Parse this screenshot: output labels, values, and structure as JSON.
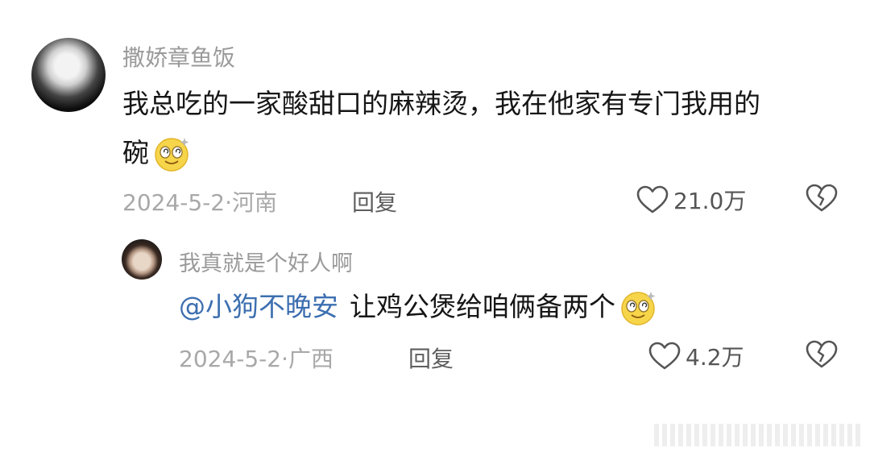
{
  "comment": {
    "username": "撒娇章鱼饭",
    "text_line1": "我总吃的一家酸甜口的麻辣烫，我在他家有专门我用的",
    "text_line2": "碗",
    "emoji": "dizzy-smile-emoji",
    "meta": "2024-5-2·河南",
    "reply_label": "回复",
    "likes": "21.0万"
  },
  "reply": {
    "username": "我真就是个好人啊",
    "mention": "@小狗不晚安",
    "text": "让鸡公煲给咱俩备两个",
    "emoji": "dizzy-smile-emoji",
    "meta": "2024-5-2·广西",
    "reply_label": "回复",
    "likes": "4.2万"
  },
  "colors": {
    "mention": "#3d6fb0",
    "meta": "#a8a8a8",
    "text": "#161616",
    "username": "#9a9a9a"
  }
}
